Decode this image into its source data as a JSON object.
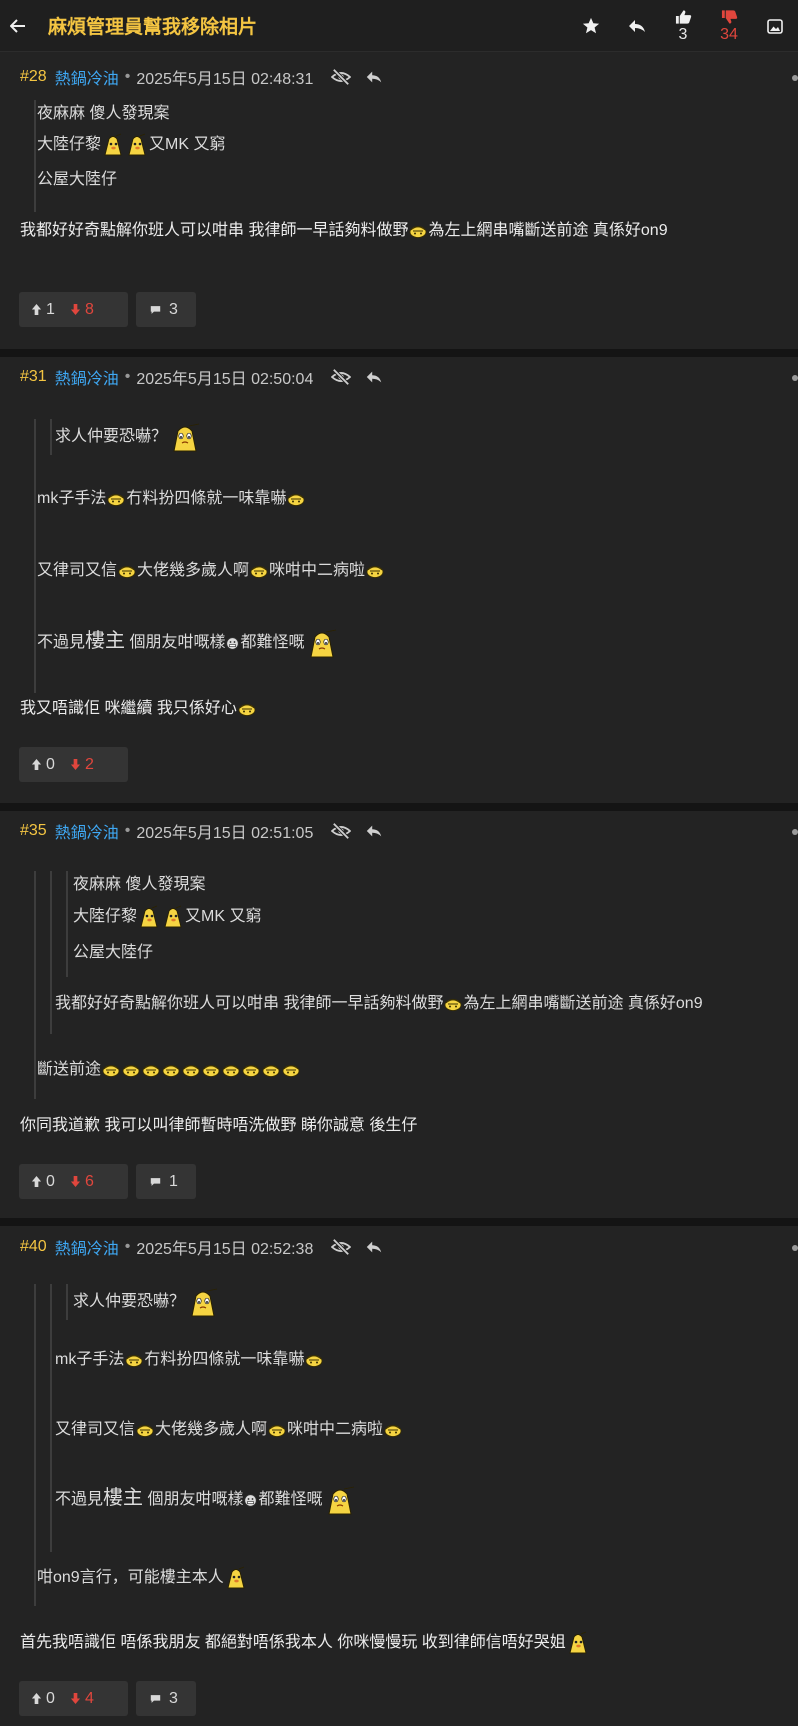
{
  "header": {
    "title": "麻煩管理員幫我移除相片",
    "upvotes": "3",
    "downvotes": "34"
  },
  "icons": {
    "back": "arrow-left-icon",
    "star": "star-icon",
    "reply": "reply-icon",
    "like": "thumbs-up-icon",
    "dislike": "thumbs-down-icon",
    "image": "image-icon",
    "hide": "eye-off-icon",
    "comment": "comment-icon"
  },
  "colors": {
    "accent": "#f4c542",
    "author": "#3fa9f5",
    "downvote": "#e0463d",
    "background": "#232323"
  },
  "posts": [
    {
      "no": "#28",
      "author": "熱鍋冷油",
      "timestamp": "2025年5月15日 02:48:31",
      "quote": [
        "夜麻麻 傻人發現案",
        "大陸仔黎",
        "又MK 又窮",
        "公屋大陸仔"
      ],
      "body_a": "我都好好奇點解你班人可以咁串 我律師一早話夠料做野",
      "body_b": "為左上網串嘴斷送前途 真係好on9",
      "up": "1",
      "down": "8",
      "comments": "3"
    },
    {
      "no": "#31",
      "author": "熱鍋冷油",
      "timestamp": "2025年5月15日 02:50:04",
      "quote_inner": "求人仲要恐嚇？",
      "quote": [
        "mk子手法",
        "冇料扮四條就一味靠嚇",
        "又律司又信",
        "大佬幾多歲人啊",
        "咪咁中二病啦",
        "不過見",
        "樓主",
        " 個朋友咁嘅樣",
        "都難怪嘅"
      ],
      "body": "我又唔識佢 咪繼續 我只係好心",
      "up": "0",
      "down": "2"
    },
    {
      "no": "#35",
      "author": "熱鍋冷油",
      "timestamp": "2025年5月15日 02:51:05",
      "quote_inner": [
        "夜麻麻 傻人發現案",
        "大陸仔黎",
        "又MK 又窮",
        "公屋大陸仔"
      ],
      "quote_mid_a": "我都好好奇點解你班人可以咁串 我律師一早話夠料做野",
      "quote_mid_b": "為左上網串嘴斷送前途 真係好on9",
      "quote": "斷送前途",
      "body": "你同我道歉 我可以叫律師暫時唔洗做野 睇你誠意 後生仔",
      "up": "0",
      "down": "6",
      "comments": "1"
    },
    {
      "no": "#40",
      "author": "熱鍋冷油",
      "timestamp": "2025年5月15日 02:52:38",
      "quote_inner": "求人仲要恐嚇？",
      "quote_mid": [
        "mk子手法",
        "冇料扮四條就一味靠嚇",
        "又律司又信",
        "大佬幾多歲人啊",
        "咪咁中二病啦",
        "不過見",
        "樓主",
        " 個朋友咁嘅樣",
        "都難怪嘅"
      ],
      "quote": "咁on9言行，可能樓主本人",
      "body": "首先我唔識佢 唔係我朋友 都絕對唔係我本人 你咪慢慢玩 收到律師信唔好哭姐",
      "up": "0",
      "down": "4",
      "comments": "3"
    }
  ]
}
